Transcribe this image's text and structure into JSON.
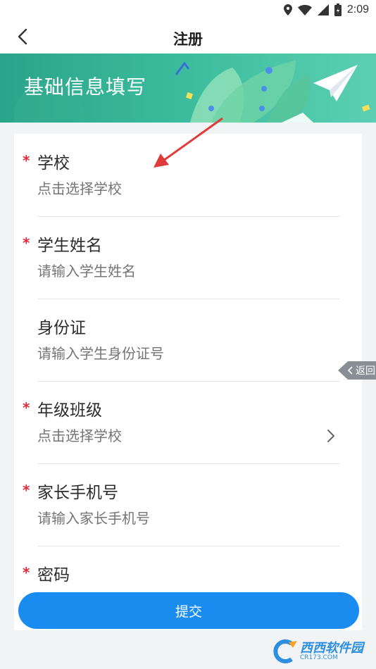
{
  "status_bar": {
    "time": "2:09"
  },
  "nav": {
    "title": "注册"
  },
  "banner": {
    "title": "基础信息填写"
  },
  "form": {
    "fields": [
      {
        "label": "学校",
        "placeholder": "点击选择学校",
        "required": true
      },
      {
        "label": "学生姓名",
        "placeholder": "请输入学生姓名",
        "required": true
      },
      {
        "label": "身份证",
        "placeholder": "请输入学生身份证号",
        "required": false
      },
      {
        "label": "年级班级",
        "placeholder": "点击选择学校",
        "required": true
      },
      {
        "label": "家长手机号",
        "placeholder": "请输入家长手机号",
        "required": true
      },
      {
        "label": "密码",
        "placeholder": "",
        "required": true
      }
    ],
    "required_mark": "*",
    "submit_label": "提交"
  },
  "float_back": {
    "label": "返回"
  },
  "watermark": {
    "main": "西西软件园",
    "sub": "CR173.COM"
  },
  "colors": {
    "accent": "#1a8cf0",
    "banner": "#2aa48a",
    "required": "#e02a39",
    "annotation_arrow": "#e03a3a"
  }
}
